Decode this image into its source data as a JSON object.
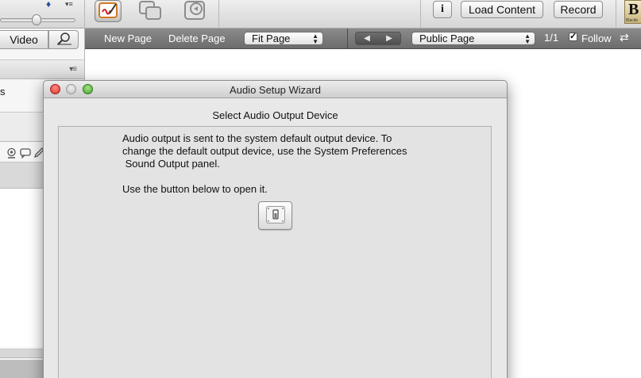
{
  "toolbar": {
    "info_label": "i",
    "load_content_label": "Load Content",
    "record_label": "Record",
    "brand_fragment": "B",
    "brand_sub": "Blackb"
  },
  "left_panel": {
    "video_label": "Video",
    "row_letter": "s"
  },
  "page_bar": {
    "new_page": "New Page",
    "delete_page": "Delete Page",
    "zoom_select": "Fit Page",
    "page_select": "Public Page",
    "page_count": "1/1",
    "follow_label": "Follow",
    "follow_checked": true
  },
  "dialog": {
    "title": "Audio Setup Wizard",
    "step_title": "Select Audio Output Device",
    "paragraph_lines": [
      "Audio output is sent to the system default output device. To",
      "change the default output device, use the System Preferences",
      " Sound Output panel."
    ],
    "instruction": "Use the button below to open it."
  },
  "colors": {
    "close_light": "#e0443e",
    "minimize_light": "#c9c9c9",
    "zoom_light": "#5bb83f",
    "subbar": "#7a7a7a"
  },
  "icons": [
    "paint-palette-icon",
    "list-menu-icon",
    "whiteboard-pen-icon",
    "windows-icon",
    "share-icon",
    "search-person-icon",
    "webcam-icon",
    "chat-icon",
    "pencil-icon",
    "sound-preferences-icon",
    "arrows-icon"
  ]
}
